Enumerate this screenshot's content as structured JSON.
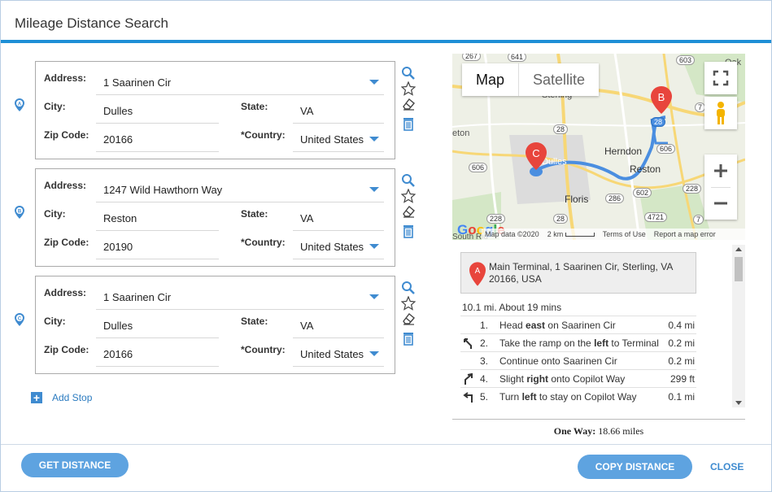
{
  "dialog": {
    "title": "Mileage Distance Search"
  },
  "labels": {
    "address": "Address:",
    "city": "City:",
    "state": "State:",
    "zip": "Zip Code:",
    "country": "*Country:"
  },
  "stops": [
    {
      "marker": "A",
      "address": "1 Saarinen Cir",
      "city": "Dulles",
      "state": "VA",
      "zip": "20166",
      "country": "United States"
    },
    {
      "marker": "B",
      "address": "1247 Wild Hawthorn Way",
      "city": "Reston",
      "state": "VA",
      "zip": "20190",
      "country": "United States"
    },
    {
      "marker": "C",
      "address": "1 Saarinen Cir",
      "city": "Dulles",
      "state": "VA",
      "zip": "20166",
      "country": "United States"
    }
  ],
  "add_stop": {
    "label": "Add Stop"
  },
  "map": {
    "tab_map": "Map",
    "tab_satellite": "Satellite",
    "google": "Google",
    "attribution": {
      "data": "Map data ©2020",
      "scale": "2 km",
      "terms": "Terms of Use",
      "report": "Report a map error"
    },
    "places": [
      "Herndon",
      "Reston",
      "Floris",
      "Dulles",
      "Sterling",
      "South Rid",
      "eton",
      "Oak"
    ],
    "route_labels": [
      "267",
      "641",
      "28",
      "606",
      "606",
      "28",
      "602",
      "286",
      "4721",
      "228",
      "606",
      "603",
      "28",
      "7",
      "7",
      "228"
    ],
    "pins": [
      "A",
      "B",
      "C"
    ],
    "colors": {
      "route": "#4a8ee0",
      "pin": "#e8453c",
      "road": "#f7d776",
      "land": "#eef0e6"
    }
  },
  "directions": {
    "start_marker": "A",
    "start_address": "Main Terminal, 1 Saarinen Cir, Sterling, VA 20166, USA",
    "summary": "10.1 mi. About 19 mins",
    "steps": [
      {
        "num": "1.",
        "text_pre": "Head ",
        "bold": "east",
        "mid": " on ",
        "road": "Saarinen Cir",
        "dist": "0.4 mi",
        "icon": ""
      },
      {
        "num": "2.",
        "text_pre": "Take the ramp on the ",
        "bold": "left",
        "mid": " to ",
        "road": "Terminal",
        "dist": "0.2 mi",
        "icon": "ramp-left-icon"
      },
      {
        "num": "3.",
        "text_pre": "Continue onto ",
        "bold": "",
        "mid": "",
        "road": "Saarinen Cir",
        "dist": "0.2 mi",
        "icon": ""
      },
      {
        "num": "4.",
        "text_pre": "Slight ",
        "bold": "right",
        "mid": " onto ",
        "road": "Copilot Way",
        "dist": "299 ft",
        "icon": "slight-right-icon"
      },
      {
        "num": "5.",
        "text_pre": "Turn ",
        "bold": "left",
        "mid": " to stay on ",
        "road": "Copilot Way",
        "dist": "0.1 mi",
        "icon": "turn-left-icon"
      }
    ]
  },
  "one_way": {
    "label": "One Way:",
    "value": "18.66 miles"
  },
  "footer": {
    "get_distance": "GET DISTANCE",
    "copy_distance": "COPY DISTANCE",
    "close": "CLOSE"
  }
}
